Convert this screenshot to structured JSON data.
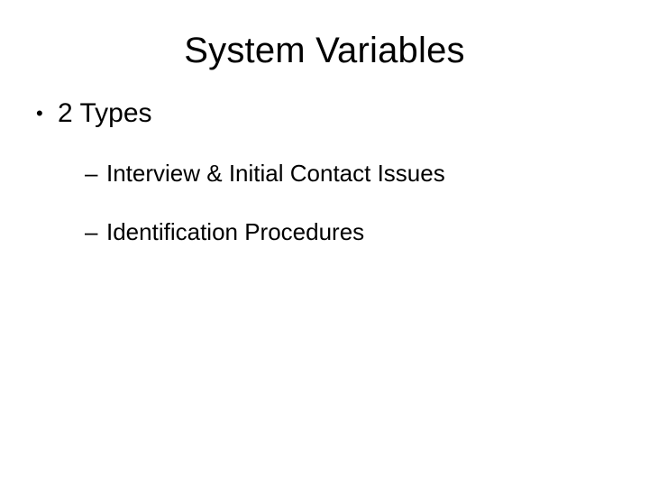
{
  "title": "System Variables",
  "bullets": {
    "level1": "2 Types",
    "sub1": "Interview & Initial Contact Issues",
    "sub2": "Identification Procedures"
  }
}
